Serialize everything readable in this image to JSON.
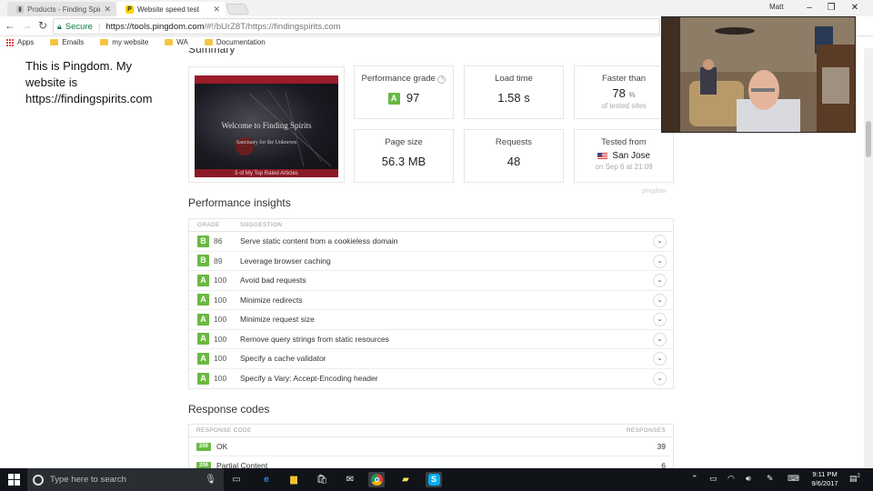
{
  "tabs": [
    {
      "title": "Products - Finding Spirits",
      "active": false
    },
    {
      "title": "Website speed test",
      "active": true
    }
  ],
  "window": {
    "user": "Matt"
  },
  "address": {
    "secure_label": "Secure",
    "url_host": "https://tools.pingdom.com",
    "url_rest": "/#!/bUrZ8T/https://findingspirits.com"
  },
  "bookmarks": [
    {
      "label": "Apps"
    },
    {
      "label": "Emails"
    },
    {
      "label": "my website"
    },
    {
      "label": "WA"
    },
    {
      "label": "Documentation"
    }
  ],
  "annotation": "This is Pingdom. My website is https://findingspirits.com",
  "summary": {
    "heading": "Summary",
    "screenshot": {
      "welcome": "Welcome to Finding Spirits",
      "sanctuary": "Sanctuary for the Unknown",
      "bottom": "5 of My Top Rated Articles"
    },
    "performance_grade_label": "Performance grade",
    "performance_grade_letter": "A",
    "performance_grade_value": "97",
    "load_time_label": "Load time",
    "load_time_value": "1.58 s",
    "faster_than_label": "Faster than",
    "faster_than_value": "78",
    "faster_than_unit": "%",
    "faster_than_sub": "of tested sites",
    "page_size_label": "Page size",
    "page_size_value": "56.3 MB",
    "requests_label": "Requests",
    "requests_value": "48",
    "tested_from_label": "Tested from",
    "tested_from_value": "San Jose",
    "tested_from_sub": "on Sep 6 at 21:09",
    "brand": "pingdom"
  },
  "insights": {
    "heading": "Performance insights",
    "col_grade": "GRADE",
    "col_suggestion": "SUGGESTION",
    "rows": [
      {
        "grade": "B",
        "score": "86",
        "suggestion": "Serve static content from a cookieless domain"
      },
      {
        "grade": "B",
        "score": "89",
        "suggestion": "Leverage browser caching"
      },
      {
        "grade": "A",
        "score": "100",
        "suggestion": "Avoid bad requests"
      },
      {
        "grade": "A",
        "score": "100",
        "suggestion": "Minimize redirects"
      },
      {
        "grade": "A",
        "score": "100",
        "suggestion": "Minimize request size"
      },
      {
        "grade": "A",
        "score": "100",
        "suggestion": "Remove query strings from static resources"
      },
      {
        "grade": "A",
        "score": "100",
        "suggestion": "Specify a cache validator"
      },
      {
        "grade": "A",
        "score": "100",
        "suggestion": "Specify a Vary: Accept-Encoding header"
      }
    ]
  },
  "responses": {
    "heading": "Response codes",
    "col_code": "RESPONSE CODE",
    "col_responses": "RESPONSES",
    "rows": [
      {
        "code": "200",
        "label": "OK",
        "count": "39"
      },
      {
        "code": "206",
        "label": "Partial Content",
        "count": "6"
      }
    ]
  },
  "taskbar": {
    "search_placeholder": "Type here to search",
    "time": "9:11 PM",
    "date": "9/6/2017",
    "notification_count": "2"
  },
  "colors": {
    "grade_green": "#6ab841",
    "secure_green": "#0b8043",
    "taskbar": "#101418"
  }
}
